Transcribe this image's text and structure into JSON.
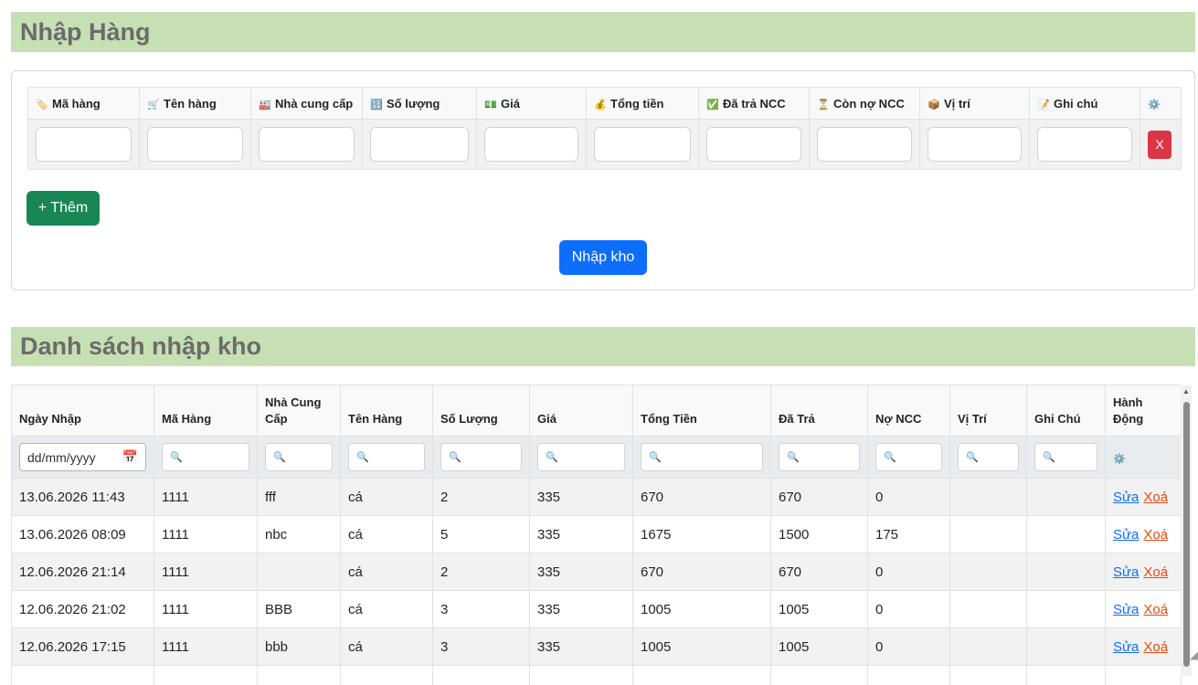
{
  "import_section": {
    "title": "Nhập Hàng",
    "columns": [
      {
        "icon": "🏷️",
        "label": "Mã hàng"
      },
      {
        "icon": "🛒",
        "label": "Tên hàng"
      },
      {
        "icon": "🏭",
        "label": "Nhà cung cấp"
      },
      {
        "icon": "🔢",
        "label": "Số lượng"
      },
      {
        "icon": "💵",
        "label": "Giá"
      },
      {
        "icon": "💰",
        "label": "Tổng tiền"
      },
      {
        "icon": "✅",
        "label": "Đã trả NCC"
      },
      {
        "icon": "⏳",
        "label": "Còn nợ NCC"
      },
      {
        "icon": "📦",
        "label": "Vị trí"
      },
      {
        "icon": "📝",
        "label": "Ghi chú"
      }
    ],
    "settings_icon": "⚙️",
    "delete_row_label": "X",
    "add_button": "+ Thêm",
    "submit_button": "Nhập kho"
  },
  "list_section": {
    "title": "Danh sách nhập kho",
    "headers": [
      "Ngày Nhập",
      "Mã Hàng",
      "Nhà Cung Cấp",
      "Tên Hàng",
      "Số Lượng",
      "Giá",
      "Tổng Tiền",
      "Đã Trả",
      "Nợ NCC",
      "Vị Trí",
      "Ghi Chú",
      "Hành Động"
    ],
    "date_filter_placeholder": "dd/mm/yyyy",
    "search_icon": "🔍",
    "settings_icon": "⚙️",
    "edit_label": "Sửa",
    "delete_label": "Xoá",
    "rows": [
      [
        "13.06.2026 11:43",
        "1111",
        "fff",
        "cá",
        "2",
        "335",
        "670",
        "670",
        "0",
        "",
        ""
      ],
      [
        "13.06.2026 08:09",
        "1111",
        "nbc",
        "cá",
        "5",
        "335",
        "1675",
        "1500",
        "175",
        "",
        ""
      ],
      [
        "12.06.2026 21:14",
        "1111",
        "",
        "cá",
        "2",
        "335",
        "670",
        "670",
        "0",
        "",
        ""
      ],
      [
        "12.06.2026 21:02",
        "1111",
        "BBB",
        "cá",
        "3",
        "335",
        "1005",
        "1005",
        "0",
        "",
        ""
      ],
      [
        "12.06.2026 17:15",
        "1111",
        "bbb",
        "cá",
        "3",
        "335",
        "1005",
        "1005",
        "0",
        "",
        ""
      ],
      [
        "",
        "",
        "",
        "",
        "",
        "",
        "",
        "",
        "",
        "",
        ""
      ]
    ]
  }
}
